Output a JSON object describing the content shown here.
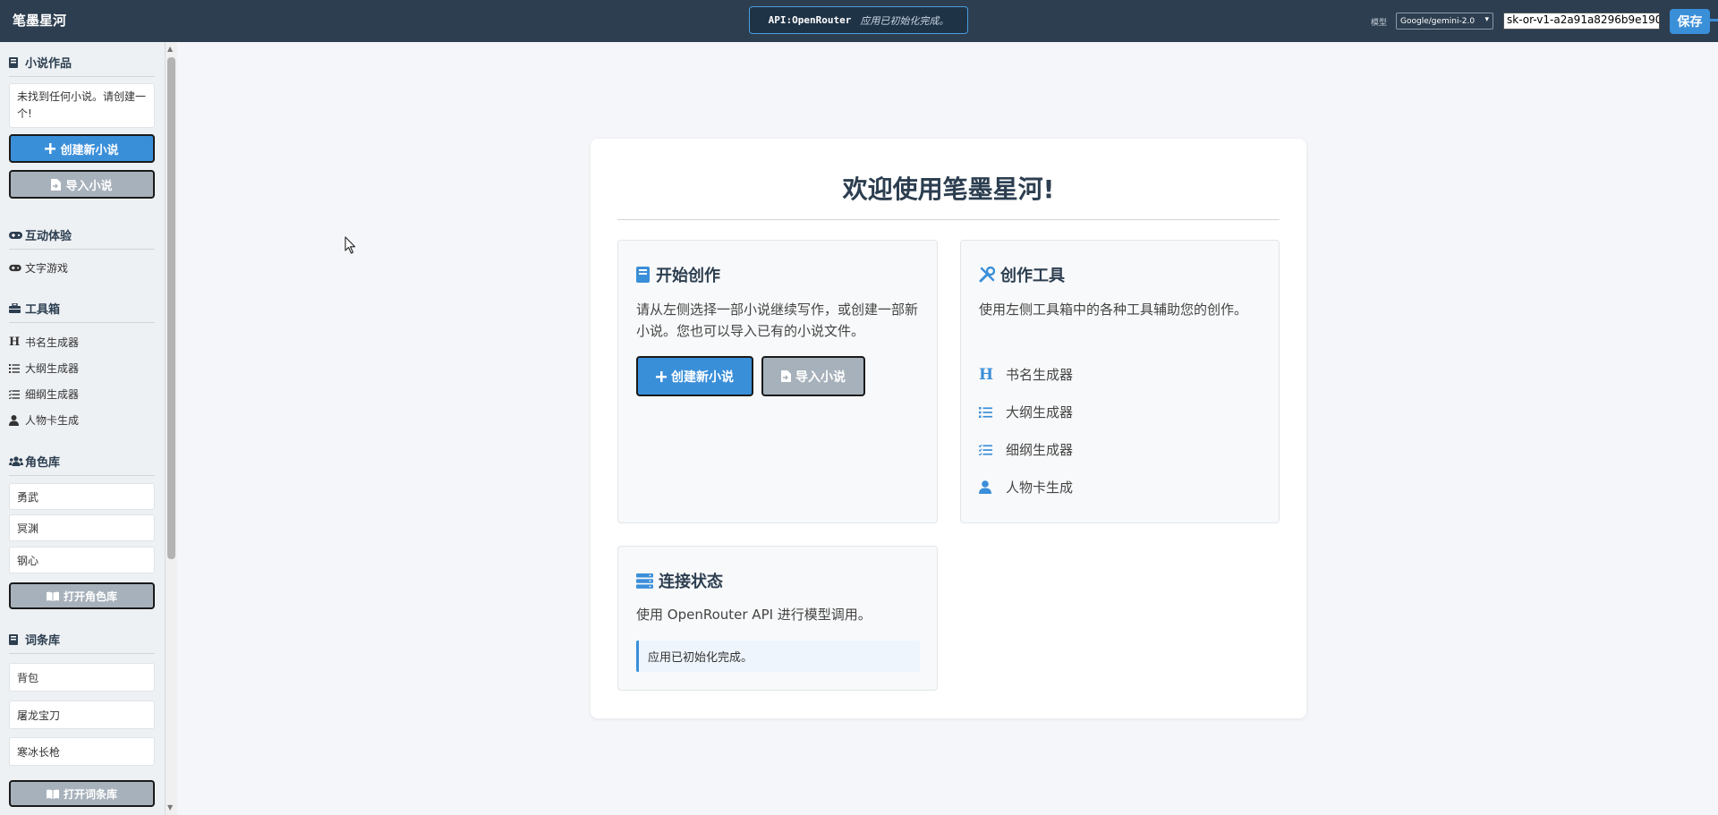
{
  "header": {
    "brand": "笔墨星河",
    "api_label": "API:OpenRouter",
    "api_message": "应用已初始化完成。",
    "model_label": "模型",
    "model_selected": "Google/gemini-2.0",
    "api_key_value": "sk-or-v1-a2a91a8296b9e190",
    "save_label": "保存"
  },
  "sidebar": {
    "novels": {
      "title": "小说作品",
      "empty_notice": "未找到任何小说。请创建一个!",
      "create_label": "创建新小说",
      "import_label": "导入小说"
    },
    "interactive": {
      "title": "互动体验",
      "items": [
        {
          "label": "文字游戏"
        }
      ]
    },
    "toolbox": {
      "title": "工具箱",
      "items": [
        {
          "label": "书名生成器"
        },
        {
          "label": "大纲生成器"
        },
        {
          "label": "细纲生成器"
        },
        {
          "label": "人物卡生成"
        }
      ]
    },
    "characters": {
      "title": "角色库",
      "items": [
        {
          "label": "勇武"
        },
        {
          "label": "冥渊"
        },
        {
          "label": "钢心"
        }
      ],
      "open_label": "打开角色库"
    },
    "glossary": {
      "title": "词条库",
      "items": [
        {
          "label": "背包"
        },
        {
          "label": "屠龙宝刀"
        },
        {
          "label": "寒冰长枪"
        }
      ],
      "open_label": "打开词条库"
    }
  },
  "main": {
    "welcome": "欢迎使用笔墨星河!",
    "start_card": {
      "title": "开始创作",
      "text": "请从左侧选择一部小说继续写作，或创建一部新小说。您也可以导入已有的小说文件。",
      "create_label": "创建新小说",
      "import_label": "导入小说"
    },
    "tools_card": {
      "title": "创作工具",
      "text": "使用左侧工具箱中的各种工具辅助您的创作。",
      "items": [
        {
          "label": "书名生成器"
        },
        {
          "label": "大纲生成器"
        },
        {
          "label": "细纲生成器"
        },
        {
          "label": "人物卡生成"
        }
      ]
    },
    "status_card": {
      "title": "连接状态",
      "text": "使用 OpenRouter API 进行模型调用。",
      "status": "应用已初始化完成。"
    }
  },
  "colors": {
    "header_bg": "#2c3e50",
    "accent": "#3a8fd9",
    "gray_button": "#a7b1bb"
  }
}
